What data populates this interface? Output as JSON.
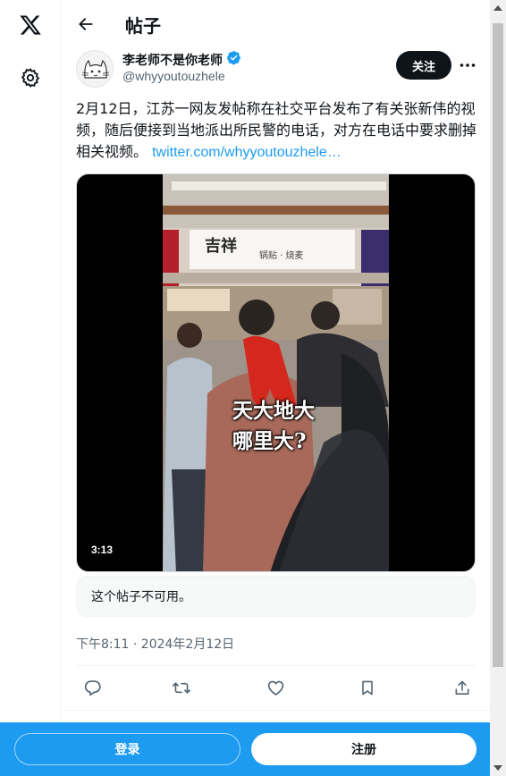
{
  "header": {
    "title": "帖子"
  },
  "author": {
    "name": "李老师不是你老师",
    "handle": "@whyyoutouzhele",
    "verified_color": "#1d9bf0",
    "follow_label": "关注"
  },
  "post": {
    "text": "2月12日，江苏一网友发帖称在社交平台发布了有关张新伟的视频，随后便接到当地派出所民警的电话，对方在电话中要求删掉相关视频。",
    "link": "twitter.com/whyyoutouzhele…",
    "timestamp": "下午8:11 · 2024年2月12日",
    "unavailable_notice": "这个帖子不可用。"
  },
  "media": {
    "duration": "3:13",
    "caption_line1": "天大地大",
    "caption_line2": "哪里大?",
    "sign_text": "吉祥",
    "sign_subtext": "锅贴 · 烧麦"
  },
  "actions": [
    "reply-icon",
    "repost-icon",
    "like-icon",
    "bookmark-icon",
    "share-icon"
  ],
  "bottom_bar": {
    "login_label": "登录",
    "signup_label": "注册",
    "color": "#1d9bf0"
  },
  "colors": {
    "accent": "#1d9bf0",
    "text": "#0f1419",
    "muted": "#536471"
  }
}
